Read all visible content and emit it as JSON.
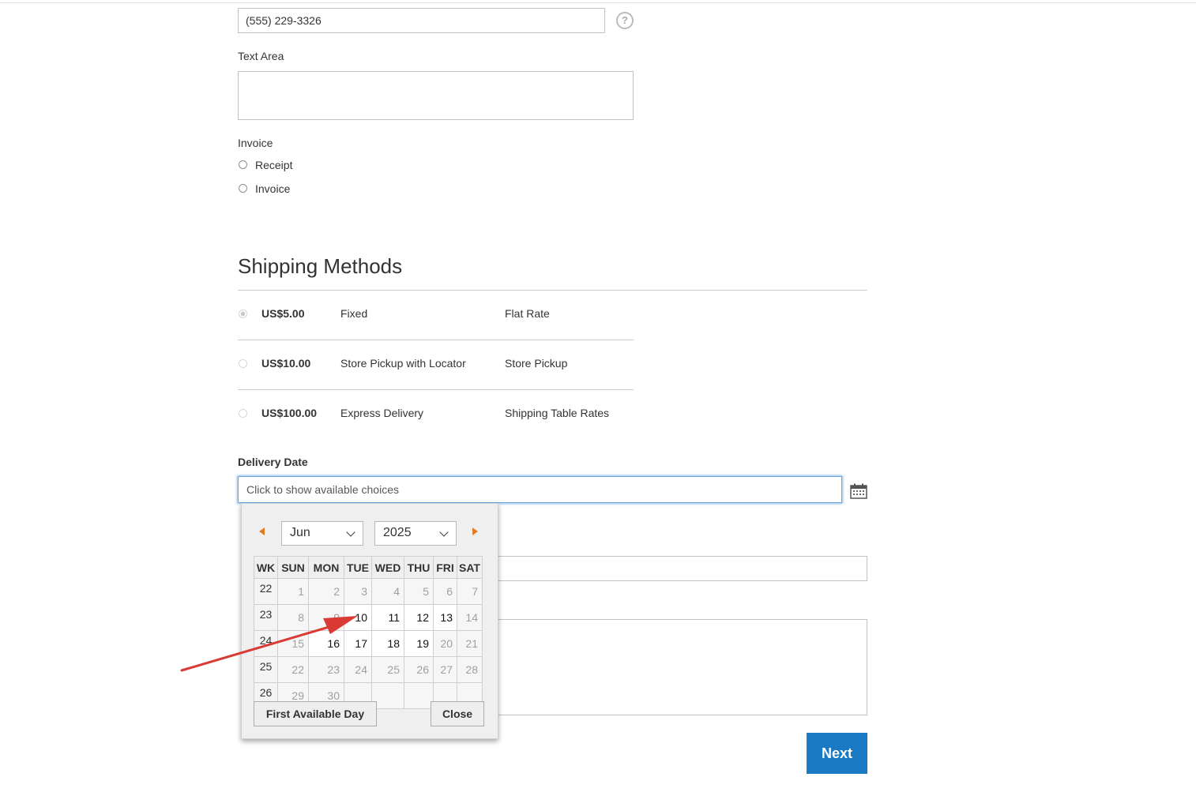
{
  "phone": {
    "value": "(555) 229-3326"
  },
  "text_area": {
    "label": "Text Area",
    "value": ""
  },
  "invoice": {
    "label": "Invoice",
    "options": [
      {
        "label": "Receipt",
        "checked": false
      },
      {
        "label": "Invoice",
        "checked": false
      }
    ]
  },
  "shipping": {
    "title": "Shipping Methods",
    "methods": [
      {
        "price": "US$5.00",
        "method": "Fixed",
        "carrier": "Flat Rate",
        "selected": true
      },
      {
        "price": "US$10.00",
        "method": "Store Pickup with Locator",
        "carrier": "Store Pickup",
        "selected": false
      },
      {
        "price": "US$100.00",
        "method": "Express Delivery",
        "carrier": "Shipping Table Rates",
        "selected": false
      }
    ]
  },
  "delivery": {
    "label": "Delivery Date",
    "placeholder": "Click to show available choices",
    "icon": "calendar-icon"
  },
  "calendar": {
    "month": "Jun",
    "year": "2025",
    "headers": [
      "WK",
      "SUN",
      "MON",
      "TUE",
      "WED",
      "THU",
      "FRI",
      "SAT"
    ],
    "weeks": [
      {
        "wk": "22",
        "days": [
          "1",
          "2",
          "3",
          "4",
          "5",
          "6",
          "7"
        ]
      },
      {
        "wk": "23",
        "days": [
          "8",
          "9",
          "10",
          "11",
          "12",
          "13",
          "14"
        ]
      },
      {
        "wk": "24",
        "days": [
          "15",
          "16",
          "17",
          "18",
          "19",
          "20",
          "21"
        ]
      },
      {
        "wk": "25",
        "days": [
          "22",
          "23",
          "24",
          "25",
          "26",
          "27",
          "28"
        ]
      },
      {
        "wk": "26",
        "days": [
          "29",
          "30",
          "",
          "",
          "",
          "",
          ""
        ]
      }
    ],
    "available_days": [
      "10",
      "11",
      "12",
      "13",
      "16",
      "17",
      "18",
      "19"
    ],
    "first_available_label": "First Available Day",
    "close_label": "Close"
  },
  "next_label": "Next",
  "annotation_arrow_color": "#d93a34"
}
